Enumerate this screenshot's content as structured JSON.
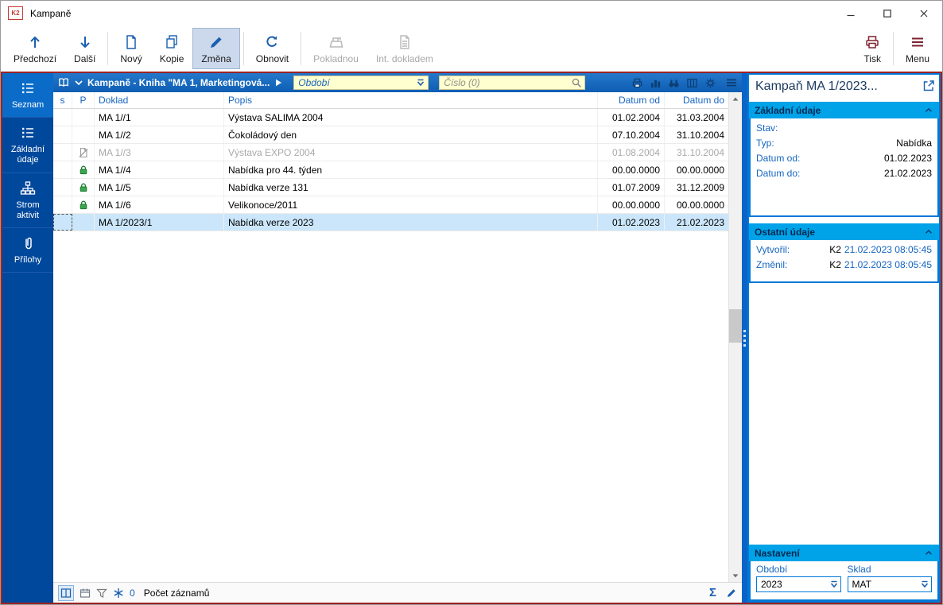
{
  "titlebar": {
    "logo": "K2",
    "title": "Kampaně"
  },
  "toolbar": {
    "buttons": [
      {
        "label": "Předchozí"
      },
      {
        "label": "Další"
      },
      {
        "label": "Nový"
      },
      {
        "label": "Kopie"
      },
      {
        "label": "Změna"
      },
      {
        "label": "Obnovit"
      },
      {
        "label": "Pokladnou"
      },
      {
        "label": "Int. dokladem"
      },
      {
        "label": "Tisk"
      },
      {
        "label": "Menu"
      }
    ]
  },
  "sidebar": {
    "items": [
      {
        "label": "Seznam"
      },
      {
        "label": "Základní údaje"
      },
      {
        "label": "Strom aktivit"
      },
      {
        "label": "Přílohy"
      }
    ]
  },
  "browse": {
    "title": "Kampaně - Kniha \"MA 1, Marketingová...",
    "period_filter": "Období",
    "number_filter": "Číslo (0)",
    "columns": {
      "s": "s",
      "p": "P",
      "doklad": "Doklad",
      "popis": "Popis",
      "datum_od": "Datum od",
      "datum_do": "Datum do"
    },
    "rows": [
      {
        "doklad": "MA 1//1",
        "popis": "Výstava SALIMA 2004",
        "datum_od": "01.02.2004",
        "datum_do": "31.03.2004"
      },
      {
        "doklad": "MA 1//2",
        "popis": "Čokoládový den",
        "datum_od": "07.10.2004",
        "datum_do": "31.10.2004"
      },
      {
        "doklad": "MA 1//3",
        "popis": "Výstava EXPO 2004",
        "datum_od": "01.08.2004",
        "datum_do": "31.10.2004"
      },
      {
        "doklad": "MA 1//4",
        "popis": "Nabídka pro 44. týden",
        "datum_od": "00.00.0000",
        "datum_do": "00.00.0000"
      },
      {
        "doklad": "MA 1//5",
        "popis": "Nabídka verze 131",
        "datum_od": "01.07.2009",
        "datum_do": "31.12.2009"
      },
      {
        "doklad": "MA 1//6",
        "popis": "Velikonoce/2011",
        "datum_od": "00.00.0000",
        "datum_do": "00.00.0000"
      },
      {
        "doklad": "MA 1/2023/1",
        "popis": "Nabídka verze 2023",
        "datum_od": "01.02.2023",
        "datum_do": "21.02.2023"
      }
    ],
    "status": {
      "filter_count": "0",
      "count_label": "Počet záznamů",
      "sum_icon": "Σ"
    }
  },
  "detail": {
    "title": "Kampaň MA 1/2023...",
    "sections": {
      "zakladni": {
        "header": "Základní údaje",
        "rows": [
          {
            "label": "Stav:",
            "value": ""
          },
          {
            "label": "Typ:",
            "value": "Nabídka"
          },
          {
            "label": "Datum od:",
            "value": "01.02.2023"
          },
          {
            "label": "Datum do:",
            "value": "21.02.2023"
          }
        ]
      },
      "ostatni": {
        "header": "Ostatní údaje",
        "rows": [
          {
            "label": "Vytvořil:",
            "user": "K2",
            "timestamp": "21.02.2023 08:05:45"
          },
          {
            "label": "Změnil:",
            "user": "K2",
            "timestamp": "21.02.2023 08:05:45"
          }
        ]
      },
      "nastaveni": {
        "header": "Nastavení",
        "fields": [
          {
            "label": "Období",
            "value": "2023"
          },
          {
            "label": "Sklad",
            "value": "MAT"
          }
        ]
      }
    }
  }
}
